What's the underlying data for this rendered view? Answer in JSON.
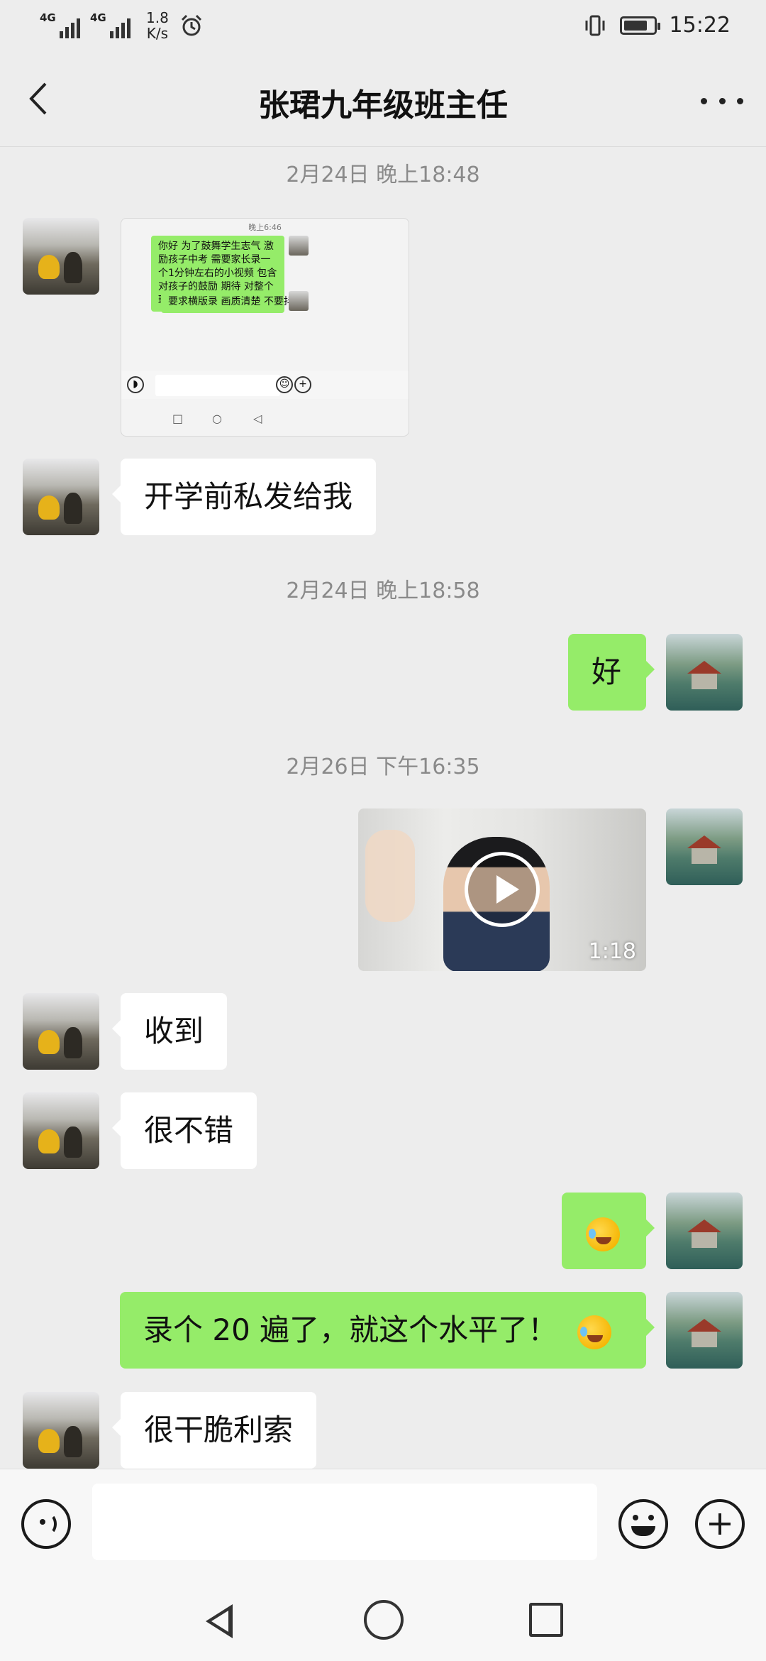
{
  "status_bar": {
    "signal1_label": "4G",
    "signal2_label": "4G",
    "speed_value": "1.8",
    "speed_unit": "K/s",
    "time": "15:22",
    "battery_level": 0.8
  },
  "header": {
    "title": "张珺九年级班主任"
  },
  "messages": {
    "ts1": "2月24日 晚上18:48",
    "screenshot": {
      "time": "晚上6:46",
      "msg1": "你好 为了鼓舞学生志气 激励孩子中考 需要家长录一个1分钟左右的小视频 包含对孩子的鼓励 期待 对整个班级和学校的祝福",
      "msg2": "要求横版录 画质清楚 不要抖动"
    },
    "m1": "开学前私发给我",
    "ts2": "2月24日 晚上18:58",
    "m2": "好",
    "ts3": "2月26日 下午16:35",
    "video_duration": "1:18",
    "m3": "收到",
    "m4": "很不错",
    "m6": "录个 20 遍了，就这个水平了！",
    "m7": "很干脆利索"
  },
  "icons": {
    "back": "chevron-left-icon",
    "more": "more-dots-icon",
    "voice": "voice-icon",
    "emoji": "emoji-icon",
    "plus": "plus-icon"
  },
  "colors": {
    "background": "#ededed",
    "sent_bubble": "#95ec69",
    "received_bubble": "#ffffff"
  }
}
